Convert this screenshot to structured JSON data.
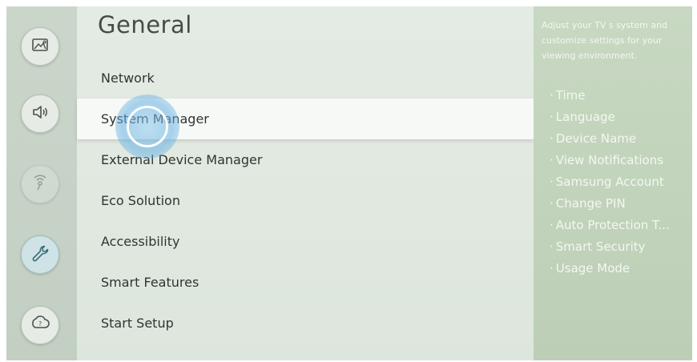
{
  "page_title": "General",
  "rail": {
    "items": [
      {
        "name": "picture-icon"
      },
      {
        "name": "sound-icon"
      },
      {
        "name": "broadcasting-icon"
      },
      {
        "name": "wrench-icon"
      },
      {
        "name": "support-icon"
      }
    ]
  },
  "menu": {
    "items": [
      {
        "label": "Network"
      },
      {
        "label": "System Manager"
      },
      {
        "label": "External Device Manager"
      },
      {
        "label": "Eco Solution"
      },
      {
        "label": "Accessibility"
      },
      {
        "label": "Smart Features"
      },
      {
        "label": "Start Setup"
      }
    ],
    "selected": "System Manager"
  },
  "info": {
    "description": "Adjust your TV s system and customize settings for your viewing environment.",
    "bullet": "·",
    "items": [
      "Time",
      "Language",
      "Device Name",
      "View Notifications",
      "Samsung Account",
      "Change PIN",
      "Auto Protection T...",
      "Smart Security",
      "Usage Mode"
    ]
  },
  "colors": {
    "selected_row": "#f7f9f7",
    "cursor_blue": "#64afe1",
    "info_panel": "#c4d4be"
  }
}
